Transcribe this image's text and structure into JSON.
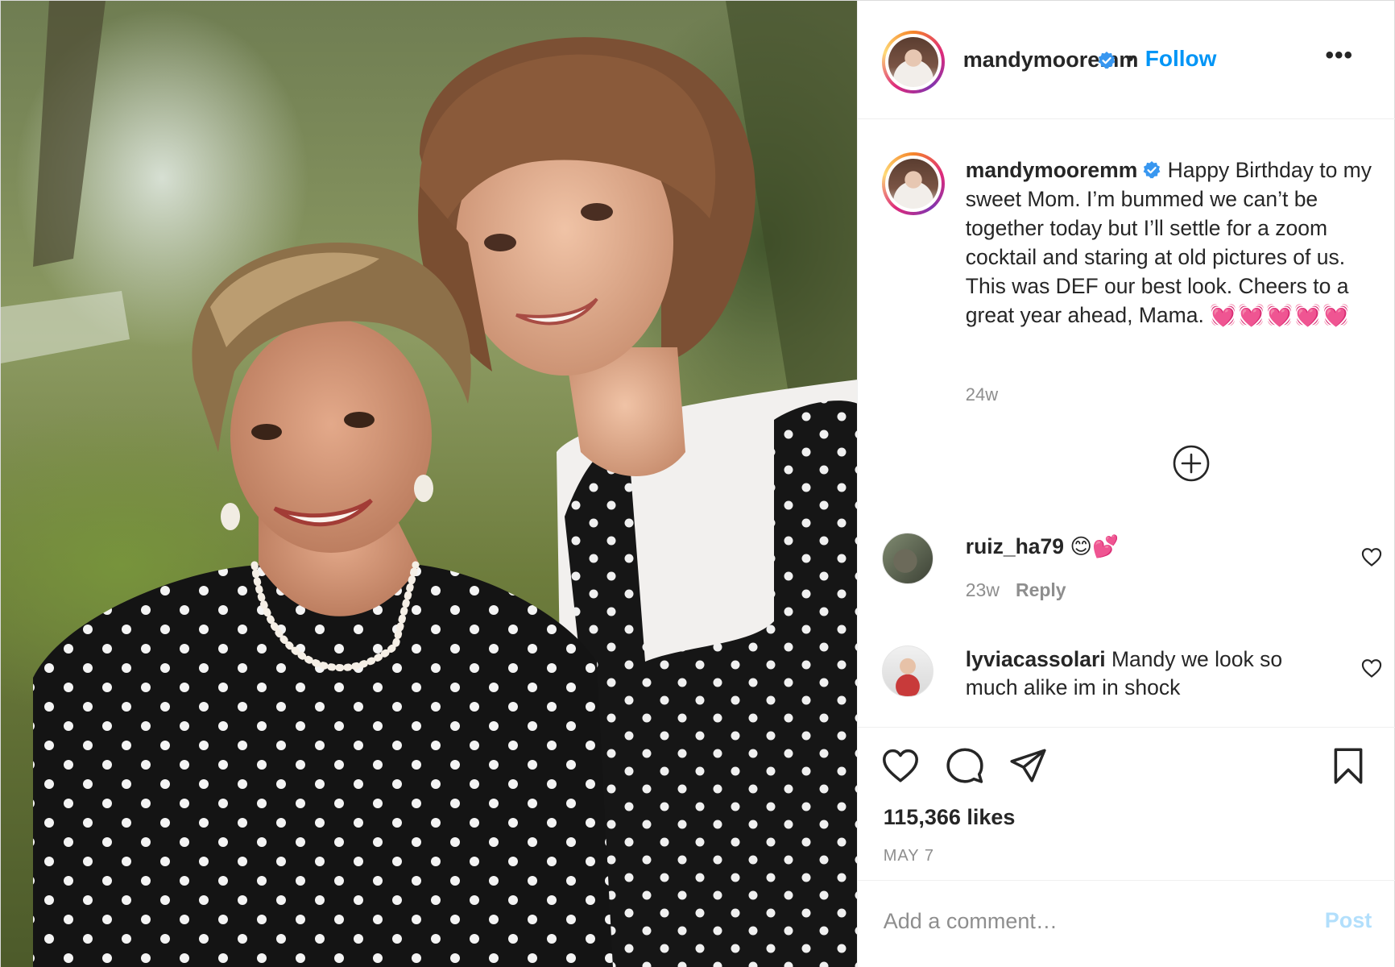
{
  "photo": {
    "description_icon": "post-photo"
  },
  "header": {
    "username": "mandymooremm",
    "verified_icon": "verified-badge-icon",
    "separator": "•",
    "follow_label": "Follow",
    "more_label": "•••"
  },
  "caption": {
    "username": "mandymooremm",
    "text": " Happy Birthday to my sweet Mom. I’m bummed we can’t be together today but I’ll settle for a zoom cocktail and staring at old pictures of us. This was DEF our best look. Cheers to a great year ahead, Mama. ",
    "emoji": "💓💓💓💓💓",
    "timestamp": "24w"
  },
  "comments": [
    {
      "username": "ruiz_ha79",
      "text": " 😊💕",
      "timestamp": "23w",
      "reply_label": "Reply"
    },
    {
      "username": "lyviacassolari",
      "text": " Mandy we look so much alike im in shock"
    }
  ],
  "actions": {
    "likes": "115,366 likes",
    "date": "MAY 7"
  },
  "add_comment": {
    "placeholder": "Add a comment…",
    "post_label": "Post"
  },
  "colors": {
    "accent": "#0095f6",
    "post_disabled": "#b2dffc",
    "secondary_text": "#8e8e8e",
    "heart_emoji": "#f04e8f"
  }
}
